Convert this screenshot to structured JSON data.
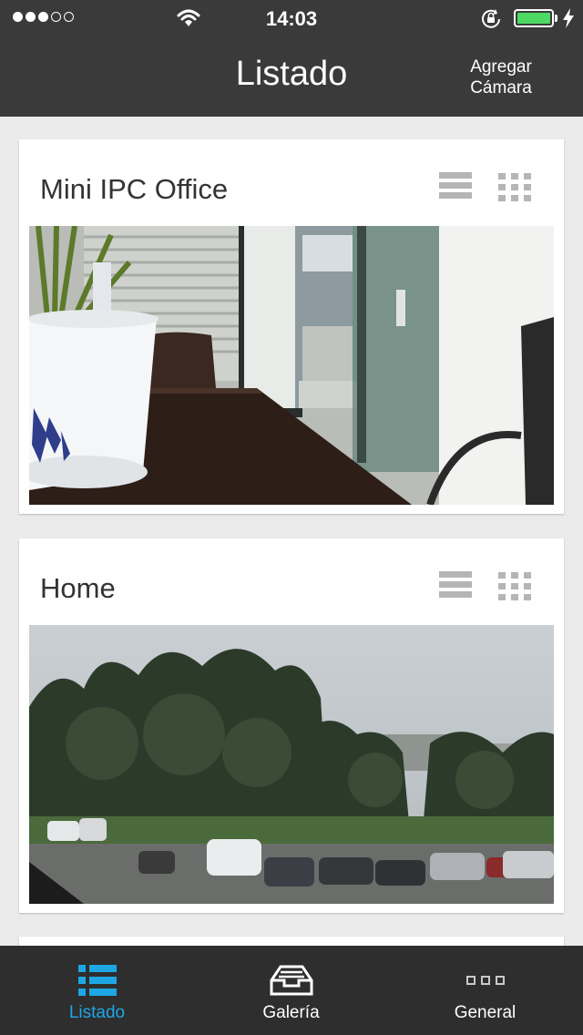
{
  "status_bar": {
    "time": "14:03",
    "signal_dots_filled": 3,
    "signal_dots_total": 5,
    "battery_level": 1.0,
    "battery_color": "#4cd964",
    "icons": [
      "wifi-icon",
      "rotation-lock-icon",
      "battery-icon",
      "charging-icon"
    ]
  },
  "nav": {
    "title": "Listado",
    "add_camera_line1": "Agregar",
    "add_camera_line2": "Cámara"
  },
  "cameras": [
    {
      "name": "Mini IPC Office",
      "feed_scene": "office"
    },
    {
      "name": "Home",
      "feed_scene": "outdoor-parking"
    }
  ],
  "tabs": [
    {
      "label": "Listado",
      "icon": "list-icon",
      "active": true
    },
    {
      "label": "Galería",
      "icon": "gallery-tray-icon",
      "active": false
    },
    {
      "label": "General",
      "icon": "more-dots-icon",
      "active": false
    }
  ],
  "colors": {
    "nav_background": "#3a3a3a",
    "tabbar_background": "#2e2e2e",
    "active_tab": "#1ea7e4",
    "page_background": "#ebebeb"
  }
}
